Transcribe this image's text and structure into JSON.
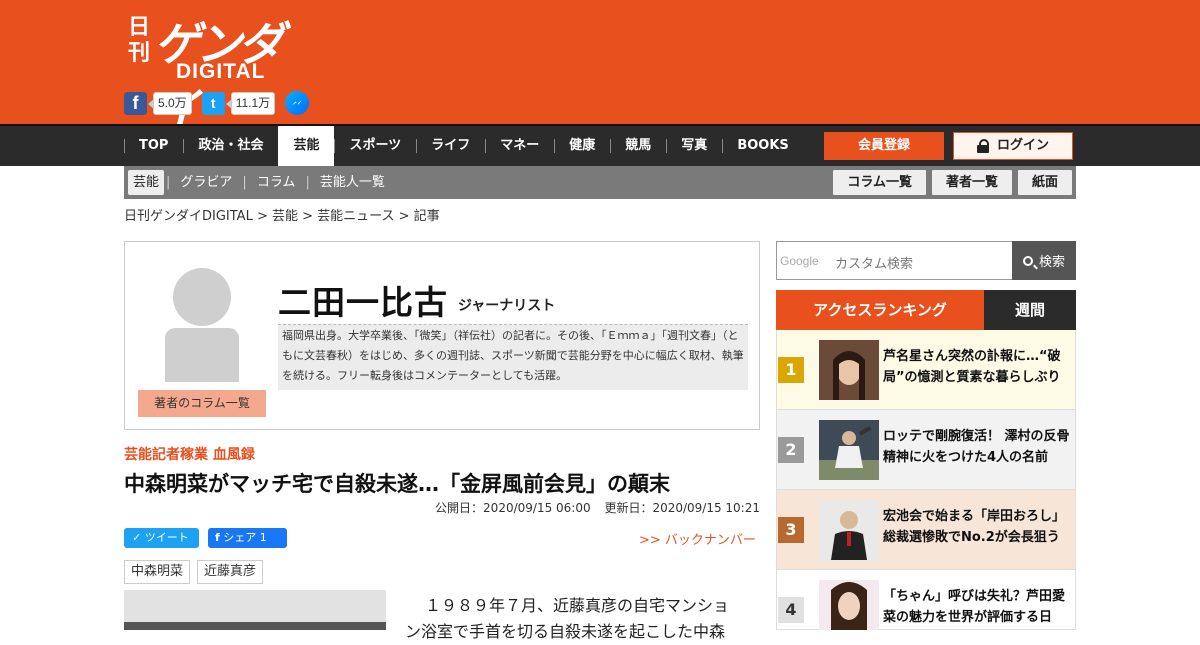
{
  "header": {
    "logo_nikkan": "日刊",
    "logo_gendai": "ゲンダイ",
    "logo_digital": "DIGITAL",
    "facebook_count": "5.0万",
    "twitter_count": "11.1万"
  },
  "nav": {
    "items": [
      "TOP",
      "政治・社会",
      "芸能",
      "スポーツ",
      "ライフ",
      "マネー",
      "健康",
      "競馬",
      "写真",
      "BOOKS"
    ],
    "active": "芸能",
    "register": "会員登録",
    "login": "ログイン"
  },
  "subnav": {
    "items": [
      "芸能",
      "グラビア",
      "コラム",
      "芸能人一覧"
    ],
    "buttons": [
      "コラム一覧",
      "著者一覧",
      "紙面"
    ]
  },
  "breadcrumb": "日刊ゲンダイDIGITAL > 芸能 > 芸能ニュース > 記事",
  "author": {
    "name": "二田一比古",
    "role": "ジャーナリスト",
    "bio": "福岡県出身。大学卒業後、「微笑」（祥伝社）の記者に。その後、「Ｅｍｍａ」「週刊文春」（ともに文芸春秋）をはじめ、多くの週刊誌、スポーツ新聞で芸能分野を中心に幅広く取材、執筆を続ける。フリー転身後はコメンテーターとしても活躍。",
    "column_link": "著者のコラム一覧"
  },
  "article": {
    "series": "芸能記者稼業 血風録",
    "title": "中森明菜がマッチ宅で自殺未遂…「金屏風前会見」の顛末",
    "published": "公開日：2020/09/15 06:00",
    "updated": "更新日：2020/09/15 10:21",
    "tweet": "ツイート",
    "share": "シェア 1",
    "back_number": ">> バックナンバー",
    "tags": [
      "中森明菜",
      "近藤真彦"
    ],
    "body_line1": "１９８９年７月、近藤真彦の自宅マンショ",
    "body_line2": "ン浴室で手首を切る自殺未遂を起こした中森"
  },
  "search": {
    "google_label": "Google",
    "placeholder": "カスタム検索",
    "button": "検索"
  },
  "ranking": {
    "title": "アクセスランキング",
    "tab": "週間",
    "items": [
      {
        "rank": "1",
        "text": "芦名星さん突然の訃報に…“破局”の憶測と質素な暮らしぶり"
      },
      {
        "rank": "2",
        "text": "ロッテで剛腕復活！ 澤村の反骨精神に火をつけた4人の名前"
      },
      {
        "rank": "3",
        "text": "宏池会で始まる「岸田おろし」総裁選惨敗でNo.2が会長狙う"
      },
      {
        "rank": "4",
        "text": "「ちゃん」呼びは失礼？芦田愛菜の魅力を世界が評価する日"
      }
    ]
  },
  "colors": {
    "brand": "#e8501e",
    "nav_bg": "#2b2b2b",
    "rank1": "#d9a700",
    "rank2": "#9a9a9a",
    "rank3": "#b86a2e",
    "rank4": "#e0e0e0"
  }
}
